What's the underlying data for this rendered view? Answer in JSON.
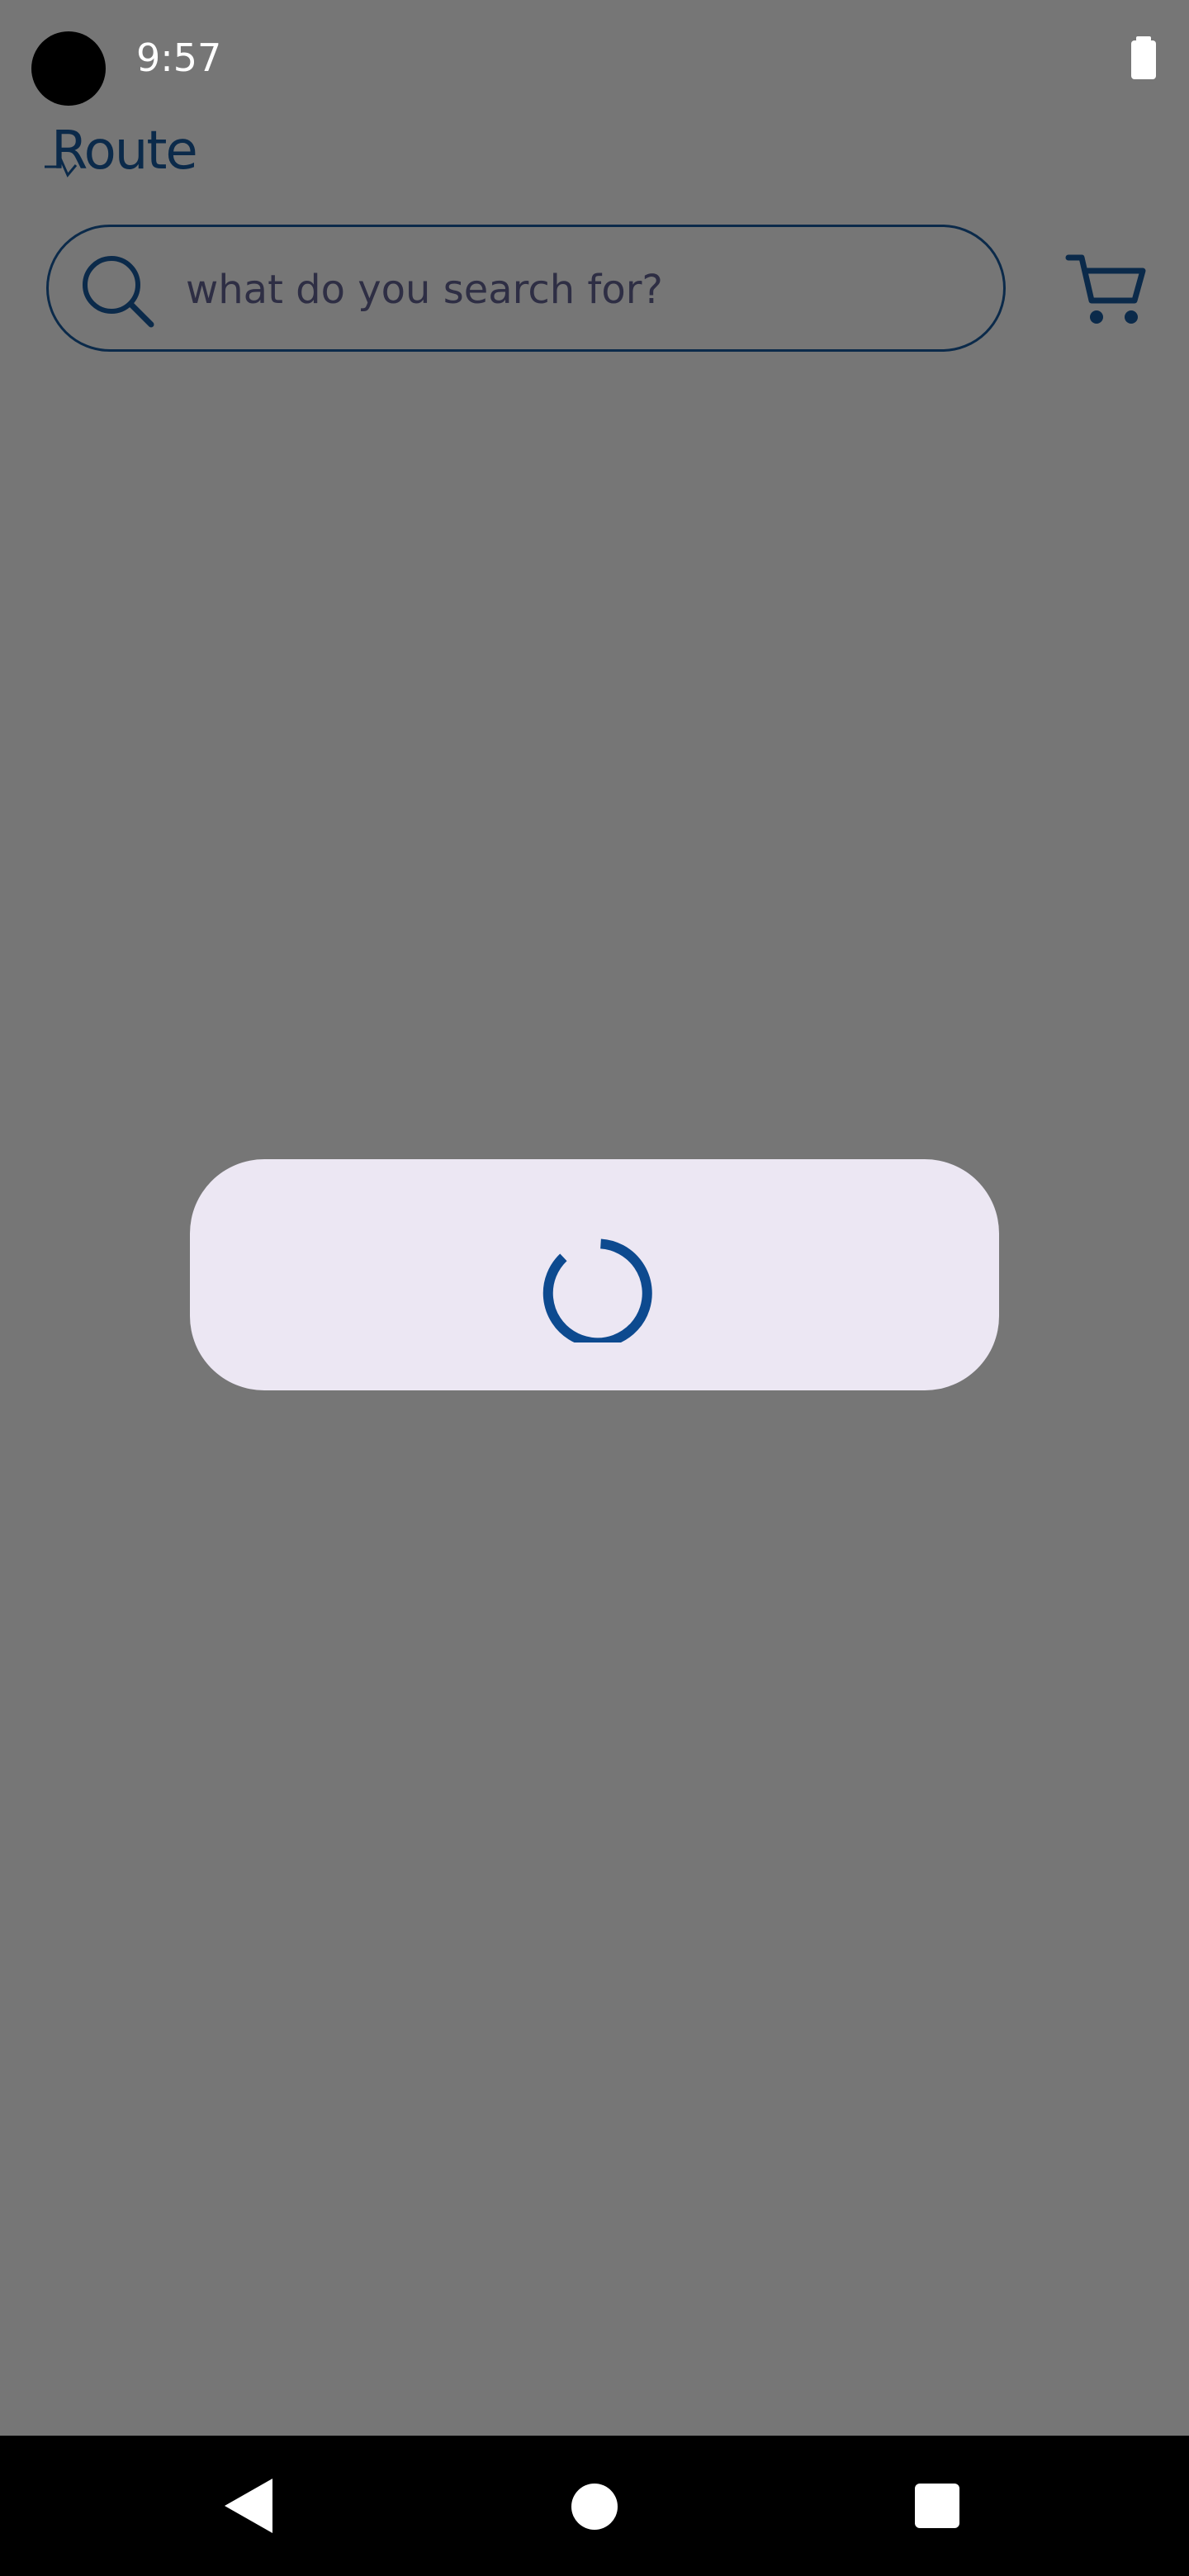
{
  "status_bar": {
    "time": "9:57",
    "icons": [
      "camera-cutout",
      "battery-icon"
    ]
  },
  "app": {
    "logo_text": "Route",
    "brand_color": "#0b2a4a"
  },
  "search": {
    "placeholder": "what do you search for?",
    "value": ""
  },
  "header_icons": [
    "search-icon",
    "cart-icon"
  ],
  "loading_dialog": {
    "state": "loading",
    "spinner_color": "#0d4a8f",
    "background_color": "#ece7f3"
  },
  "nav_bar": {
    "buttons": [
      "back-icon",
      "home-icon",
      "recents-icon"
    ]
  },
  "colors": {
    "overlay": "#767676",
    "nav_bar": "#000000"
  }
}
